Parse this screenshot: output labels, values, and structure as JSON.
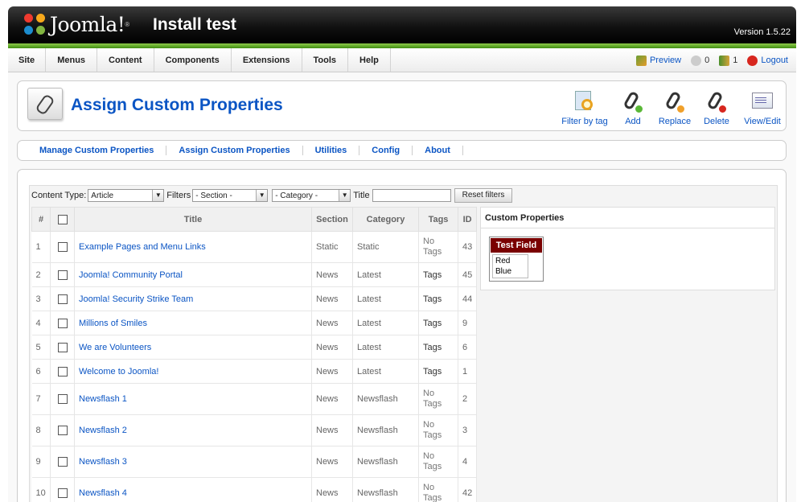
{
  "header": {
    "logo_word": "Joomla!",
    "logo_reg": "®",
    "site_title": "Install test",
    "version": "Version 1.5.22"
  },
  "menu": [
    "Site",
    "Menus",
    "Content",
    "Components",
    "Extensions",
    "Tools",
    "Help"
  ],
  "status": {
    "preview": "Preview",
    "messages": "0",
    "users": "1",
    "logout": "Logout"
  },
  "toolbar": {
    "title": "Assign Custom Properties",
    "buttons": [
      "Filter by tag",
      "Add",
      "Replace",
      "Delete",
      "View/Edit"
    ]
  },
  "subnav": [
    "Manage Custom Properties",
    "Assign Custom Properties",
    "Utilities",
    "Config",
    "About"
  ],
  "filters": {
    "content_type_label": "Content Type:",
    "content_type_value": "Article",
    "filters_label": "Filters",
    "section_value": "- Section -",
    "category_value": "- Category -",
    "title_label": "Title",
    "reset_label": "Reset filters"
  },
  "table": {
    "headers": [
      "#",
      "",
      "Title",
      "Section",
      "Category",
      "Tags",
      "ID"
    ],
    "rows": [
      {
        "num": "1",
        "title": "Example Pages and Menu Links",
        "section": "Static",
        "category": "Static",
        "tags": "No Tags",
        "id": "43"
      },
      {
        "num": "2",
        "title": "Joomla! Community Portal",
        "section": "News",
        "category": "Latest",
        "tags": "Tags",
        "id": "45"
      },
      {
        "num": "3",
        "title": "Joomla! Security Strike Team",
        "section": "News",
        "category": "Latest",
        "tags": "Tags",
        "id": "44"
      },
      {
        "num": "4",
        "title": "Millions of Smiles",
        "section": "News",
        "category": "Latest",
        "tags": "Tags",
        "id": "9"
      },
      {
        "num": "5",
        "title": "We are Volunteers",
        "section": "News",
        "category": "Latest",
        "tags": "Tags",
        "id": "6"
      },
      {
        "num": "6",
        "title": "Welcome to Joomla!",
        "section": "News",
        "category": "Latest",
        "tags": "Tags",
        "id": "1"
      },
      {
        "num": "7",
        "title": "Newsflash 1",
        "section": "News",
        "category": "Newsflash",
        "tags": "No Tags",
        "id": "2"
      },
      {
        "num": "8",
        "title": "Newsflash 2",
        "section": "News",
        "category": "Newsflash",
        "tags": "No Tags",
        "id": "3"
      },
      {
        "num": "9",
        "title": "Newsflash 3",
        "section": "News",
        "category": "Newsflash",
        "tags": "No Tags",
        "id": "4"
      },
      {
        "num": "10",
        "title": "Newsflash 4",
        "section": "News",
        "category": "Newsflash",
        "tags": "No Tags",
        "id": "42"
      }
    ]
  },
  "custom_properties": {
    "heading": "Custom Properties",
    "field_name": "Test Field",
    "options": [
      "Red",
      "Blue"
    ]
  }
}
